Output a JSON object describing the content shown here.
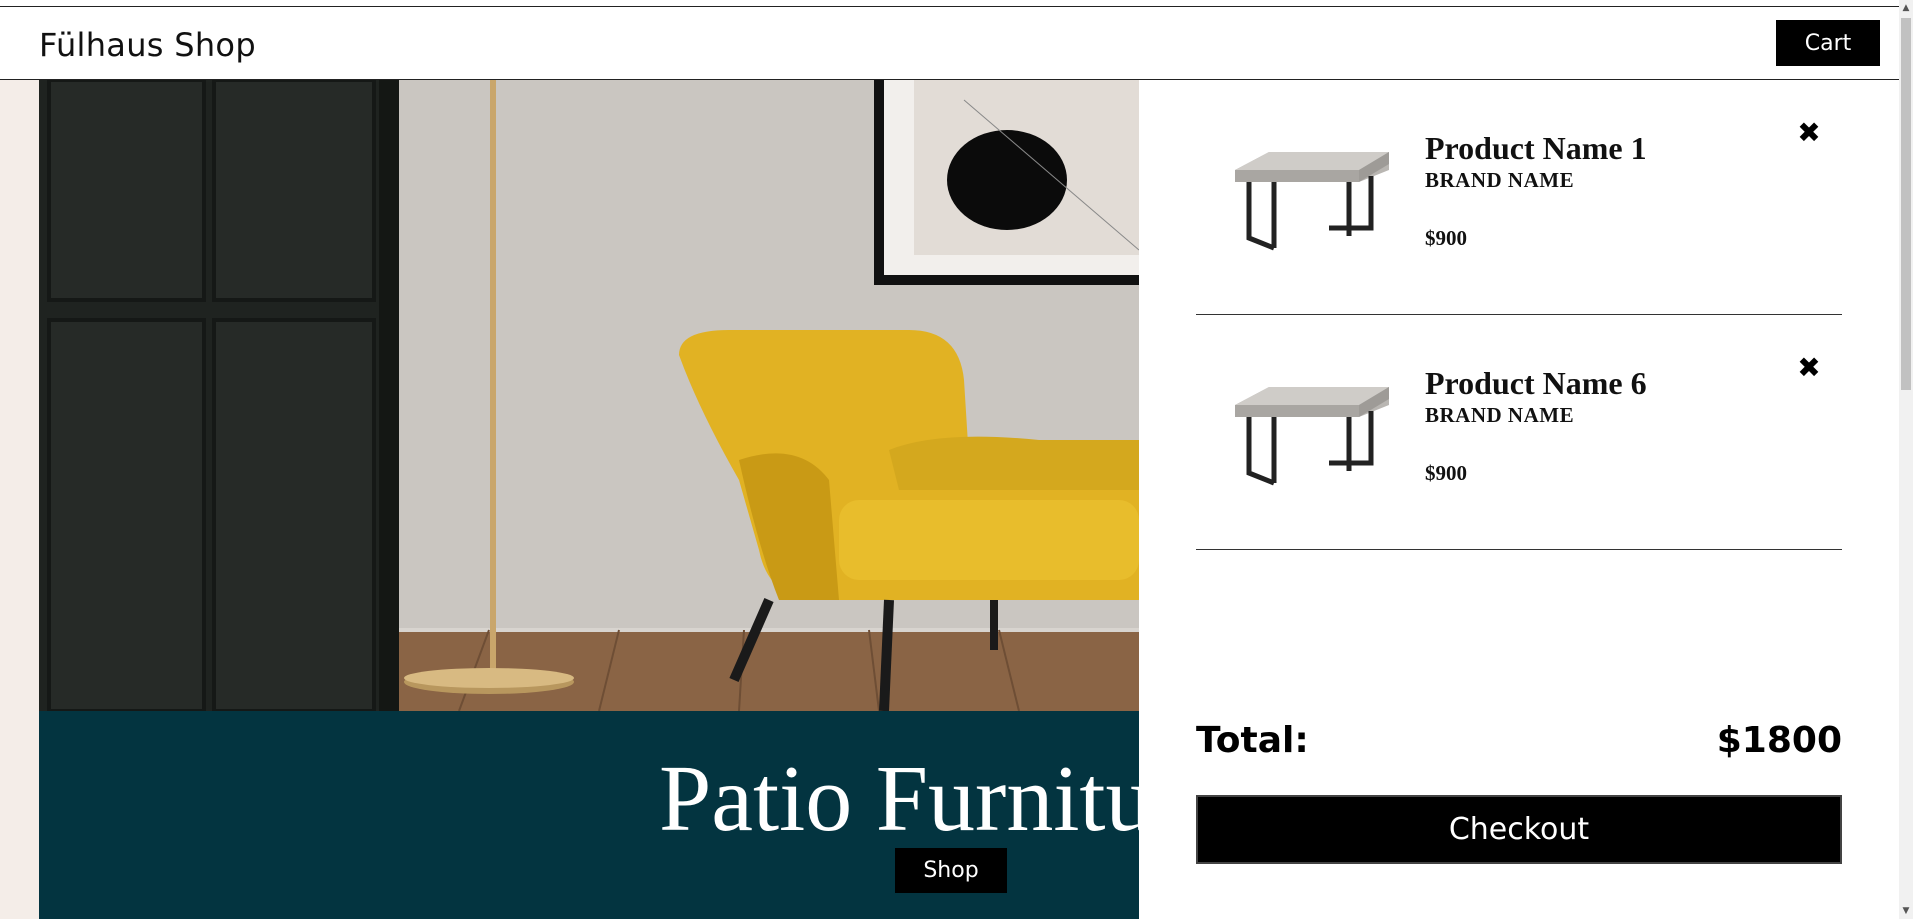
{
  "header": {
    "brand": "Fülhaus Shop",
    "cart_label": "Cart"
  },
  "hero": {
    "image": "yellow-armchair-photo"
  },
  "banner": {
    "title": "Patio Furniture",
    "shop_label": "Shop",
    "background_color": "#033440"
  },
  "cart": {
    "items": [
      {
        "name": "Product Name 1",
        "brand": "BRAND NAME",
        "price": "$900",
        "thumb_icon": "table-icon",
        "remove_icon": "close-icon"
      },
      {
        "name": "Product Name 6",
        "brand": "BRAND NAME",
        "price": "$900",
        "thumb_icon": "table-icon",
        "remove_icon": "close-icon"
      }
    ],
    "total_label": "Total:",
    "total_value": "$1800",
    "checkout_label": "Checkout",
    "remove_glyph": "✖"
  }
}
